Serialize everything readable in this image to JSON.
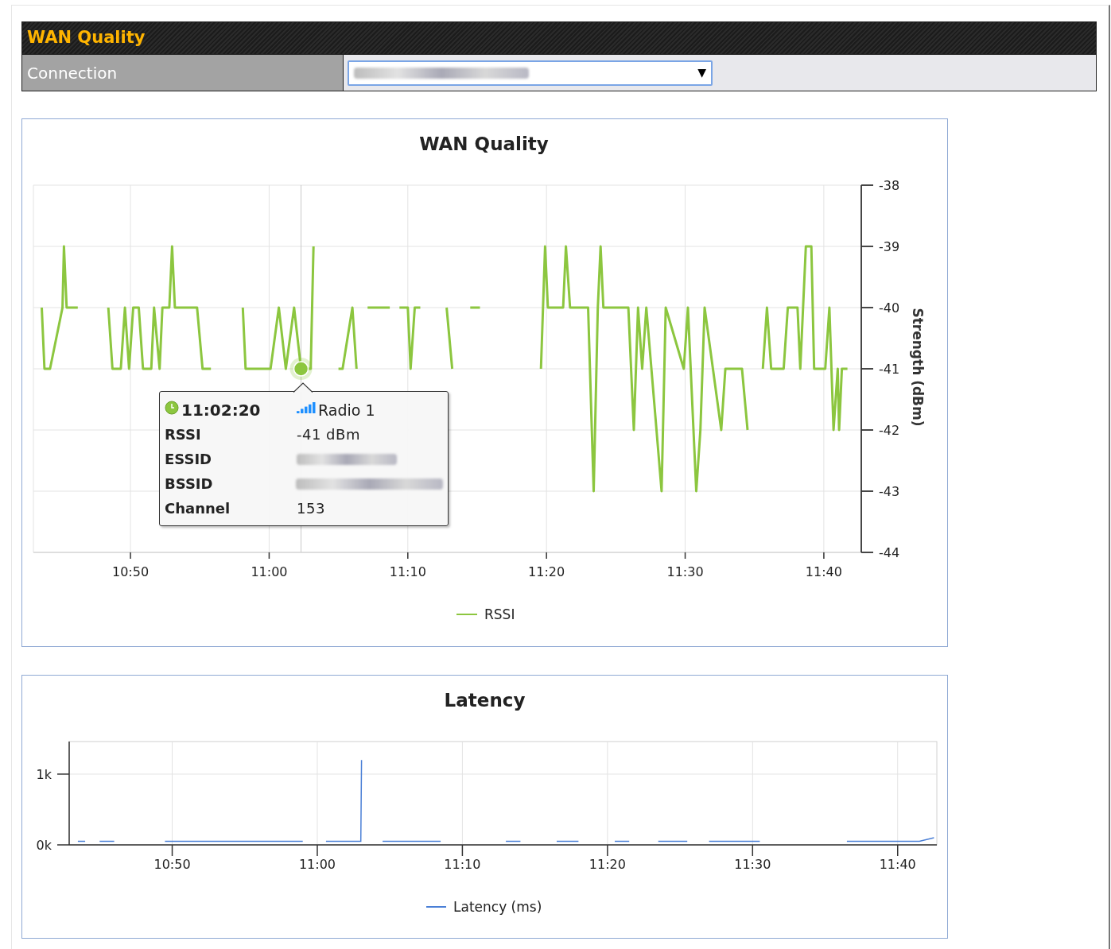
{
  "section": {
    "title": "WAN Quality"
  },
  "connection": {
    "label": "Connection",
    "dropdown_arrow": "▼"
  },
  "wan_quality": {
    "chart_data": {
      "type": "line",
      "grid": true,
      "ref_lines": [
        {
          "axis": "x",
          "value": 662.3
        }
      ],
      "title": "WAN Quality",
      "ylabel": "Strength (dBm)",
      "xlim": [
        643,
        702.7
      ],
      "ylim": [
        -44,
        -38
      ],
      "xticks": [
        {
          "value": 650,
          "label": "10:50"
        },
        {
          "value": 660,
          "label": "11:00"
        },
        {
          "value": 670,
          "label": "11:10"
        },
        {
          "value": 680,
          "label": "11:20"
        },
        {
          "value": 690,
          "label": "11:30"
        },
        {
          "value": 700,
          "label": "11:40"
        }
      ],
      "yticks": [
        -44,
        -43,
        -42,
        -41,
        -40,
        -39,
        -38
      ],
      "x": [
        643.6,
        643.8,
        644.2,
        645.1,
        645.2,
        645.4,
        646.2,
        647.0,
        648.4,
        648.7,
        649.3,
        649.6,
        649.9,
        650.2,
        650.6,
        650.9,
        651.5,
        651.7,
        652.1,
        652.3,
        652.8,
        653.0,
        653.2,
        654.8,
        655.2,
        655.8,
        657.0,
        658.1,
        658.3,
        660.1,
        660.7,
        661.2,
        661.8,
        662.3,
        663.0,
        663.2,
        663.4,
        665.0,
        665.3,
        666.0,
        666.3,
        667.0,
        667.1,
        668.7,
        669.0,
        669.4,
        670.0,
        670.2,
        670.5,
        670.9,
        671.5,
        672.8,
        673.2,
        673.6,
        674.5,
        675.2,
        675.6,
        679.6,
        679.9,
        680.1,
        681.2,
        681.4,
        681.7,
        683.0,
        683.4,
        683.7,
        683.9,
        684.1,
        685.9,
        686.3,
        686.6,
        686.9,
        687.2,
        688.3,
        688.6,
        689.9,
        690.2,
        690.8,
        691.1,
        691.4,
        692.6,
        692.9,
        694.1,
        694.5,
        695.0,
        695.6,
        695.9,
        696.2,
        697.1,
        697.4,
        698.1,
        698.3,
        698.7,
        699.1,
        699.3,
        700.1,
        700.4,
        700.7,
        701.0,
        701.1,
        701.3,
        701.7
      ],
      "series": [
        {
          "name": "RSSI",
          "color": "#8cc63f",
          "values": [
            -40,
            -41,
            -41,
            -40,
            -39,
            -40,
            -40,
            null,
            -40,
            -41,
            -41,
            -40,
            -41,
            -40,
            -40,
            -41,
            -41,
            -40,
            -41,
            -40,
            -40,
            -39,
            -40,
            -40,
            -41,
            -41,
            null,
            -40,
            -41,
            -41,
            -40,
            -41,
            -40,
            -41,
            -41,
            -39,
            null,
            -41,
            -41,
            -40,
            -41,
            null,
            -40,
            -40,
            null,
            -40,
            -40,
            -41,
            -40,
            -40,
            null,
            -40,
            -41,
            null,
            -40,
            -40,
            null,
            -41,
            -39,
            -40,
            -40,
            -39,
            -40,
            -40,
            -43,
            -40,
            -39,
            -40,
            -40,
            -42,
            -40,
            -41,
            -40,
            -43,
            -40,
            -41,
            -40,
            -43,
            -42,
            -40,
            -42,
            -41,
            -41,
            -42,
            null,
            -41,
            -40,
            -41,
            -41,
            -40,
            -40,
            -41,
            -39,
            -39,
            -41,
            -41,
            -40,
            -42,
            -41,
            -42,
            -41,
            -41
          ]
        }
      ]
    },
    "tooltip": {
      "time": "11:02:20",
      "radio": "Radio 1",
      "rows": [
        {
          "label": "RSSI",
          "kind": "value",
          "value": "-41 dBm"
        },
        {
          "label": "ESSID",
          "kind": "redacted"
        },
        {
          "label": "BSSID",
          "kind": "redacted"
        },
        {
          "label": "Channel",
          "kind": "value",
          "value": "153"
        }
      ]
    }
  },
  "latency": {
    "chart_data": {
      "type": "line",
      "grid": true,
      "title": "Latency",
      "xlim": [
        642.9,
        702.7
      ],
      "ylim": [
        0,
        1460
      ],
      "xticks": [
        {
          "value": 650,
          "label": "10:50"
        },
        {
          "value": 660,
          "label": "11:00"
        },
        {
          "value": 670,
          "label": "11:10"
        },
        {
          "value": 680,
          "label": "11:20"
        },
        {
          "value": 690,
          "label": "11:30"
        },
        {
          "value": 700,
          "label": "11:40"
        }
      ],
      "yticks": [
        {
          "value": 0,
          "label": "0k"
        },
        {
          "value": 1000,
          "label": "1k"
        }
      ],
      "x": [
        643.5,
        644,
        644.5,
        645,
        646,
        647,
        649.5,
        650.5,
        651.5,
        652.5,
        653.5,
        655,
        656,
        657,
        658,
        659,
        660,
        660.6,
        661.5,
        662.5,
        663.0,
        663.05,
        663.1,
        664.5,
        665.5,
        666.5,
        667.5,
        668.5,
        669.5,
        671,
        672,
        673,
        674,
        675,
        676.5,
        678,
        679.5,
        680.5,
        681.5,
        682,
        683.5,
        684.5,
        685.5,
        686,
        687,
        688.5,
        689.5,
        690.5,
        691,
        692,
        693,
        694.5,
        695.5,
        696.5,
        697.5,
        698.5,
        699.5,
        700.5,
        701.5,
        702.5
      ],
      "series": [
        {
          "name": "Latency (ms)",
          "color": "#4a7fd6",
          "values": [
            50,
            50,
            null,
            50,
            50,
            null,
            50,
            50,
            50,
            50,
            50,
            50,
            50,
            50,
            50,
            50,
            null,
            50,
            50,
            50,
            50,
            1200,
            null,
            50,
            50,
            50,
            50,
            50,
            null,
            null,
            null,
            50,
            50,
            null,
            50,
            50,
            null,
            50,
            50,
            null,
            50,
            50,
            50,
            null,
            50,
            50,
            50,
            50,
            null,
            null,
            null,
            null,
            null,
            50,
            50,
            50,
            50,
            50,
            50,
            100
          ]
        }
      ]
    }
  }
}
